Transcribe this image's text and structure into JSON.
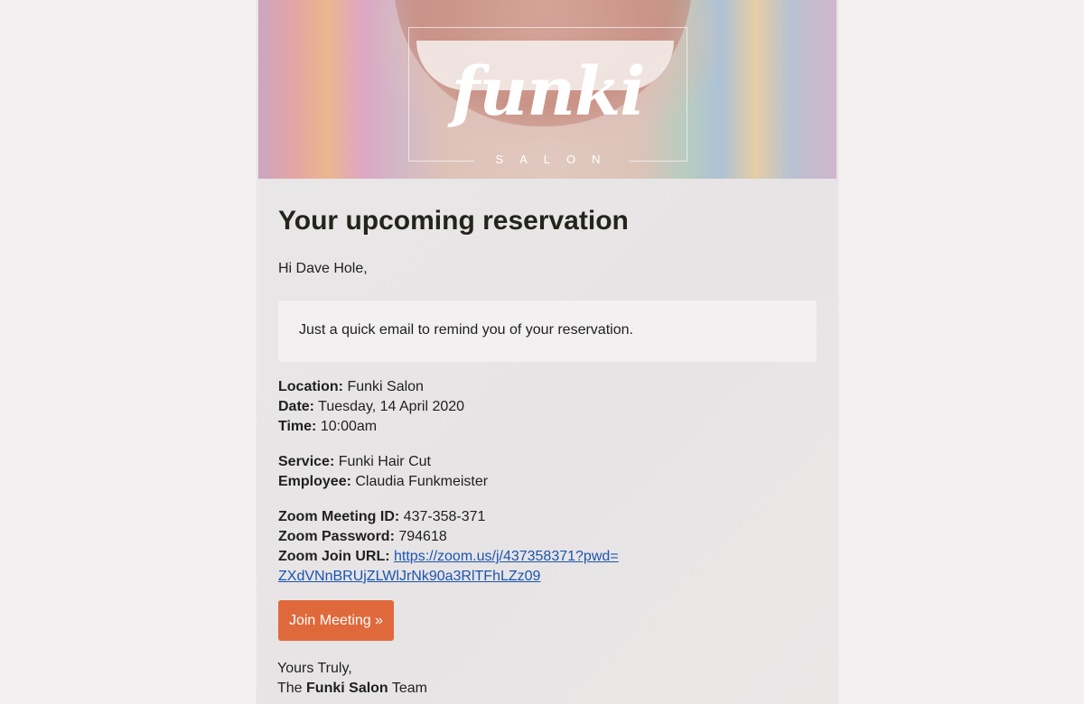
{
  "header": {
    "logo_text": "funki",
    "logo_sub": "SALON"
  },
  "title": "Your upcoming reservation",
  "greeting": "Hi Dave Hole,",
  "notice": "Just a quick email to remind you of your reservation.",
  "details": {
    "location_label": "Location:",
    "location": "Funki Salon",
    "date_label": "Date:",
    "date": "Tuesday, 14 April 2020",
    "time_label": "Time:",
    "time": "10:00am",
    "service_label": "Service:",
    "service": "Funki Hair Cut",
    "employee_label": "Employee:",
    "employee": "Claudia Funkmeister",
    "zoom_id_label": "Zoom Meeting ID:",
    "zoom_id": "437-358-371",
    "zoom_password_label": "Zoom Password:",
    "zoom_password": "794618",
    "zoom_url_label": "Zoom Join URL:",
    "zoom_url_line1": "https://zoom.us/j/437358371?pwd=",
    "zoom_url_line2": "ZXdVNnBRUjZLWlJrNk90a3RlTFhLZz09"
  },
  "join_button": "Join Meeting »",
  "signoff": {
    "line1": "Yours Truly,",
    "prefix": "The",
    "team_name": "Funki Salon",
    "suffix": "Team"
  },
  "colors": {
    "page_bg": "#f4eff0",
    "button": "#e0693b",
    "link": "#1a55b0",
    "heading": "#23241c"
  }
}
